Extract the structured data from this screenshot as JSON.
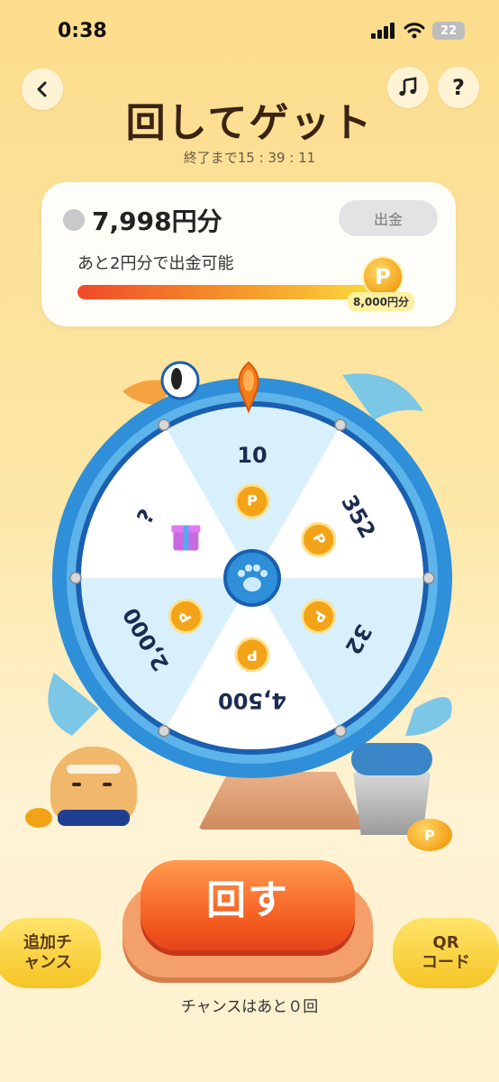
{
  "status_bar": {
    "time": "0:38",
    "battery": "22"
  },
  "header": {
    "back_icon": "chevron-left-icon",
    "music_icon": "music-note-icon",
    "help_label": "?",
    "title": "回してゲット",
    "timer": "終了まで15 : 39 : 11"
  },
  "balance": {
    "amount": "7,998円分",
    "withdraw_label": "出金",
    "hint": "あと2円分で出金可能",
    "progress": 0.99975,
    "goal_label": "8,000円分",
    "coin_label": "P"
  },
  "wheel": {
    "segments": [
      {
        "label": "10"
      },
      {
        "label": "352"
      },
      {
        "label": "32"
      },
      {
        "label": "4,500"
      },
      {
        "label": "2,000"
      },
      {
        "label": "?"
      }
    ],
    "coin_label": "P",
    "center_icon": "paw-icon",
    "pointer_icon": "pin-icon",
    "gift_icon": "gift-icon"
  },
  "controls": {
    "spin_label": "回す",
    "extra_chance_label": [
      "追加チ",
      "ャンス"
    ],
    "qr_label": [
      "QR",
      "コード"
    ],
    "remaining": "チャンスはあと０回"
  },
  "colors": {
    "accent": "#f35a1e",
    "wheel_blue": "#2f8fd8",
    "coin": "#f3a318"
  }
}
